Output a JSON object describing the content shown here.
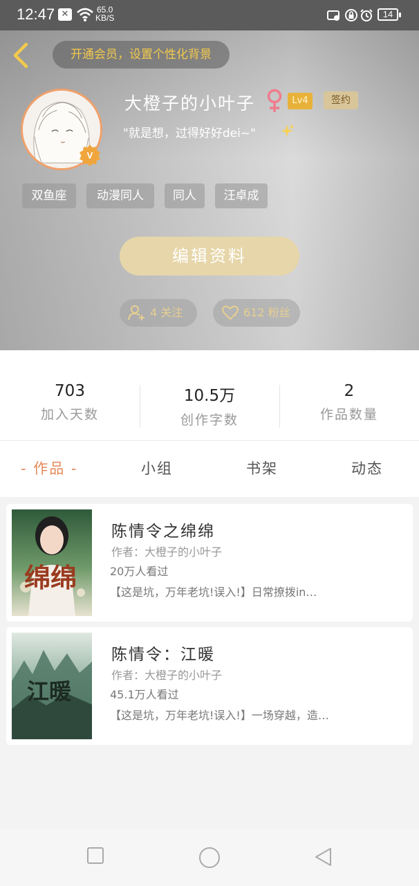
{
  "status": {
    "time": "12:47",
    "net_speed": "65.0",
    "net_unit": "KB/S",
    "battery": "14"
  },
  "header": {
    "vip_banner": "开通会员，设置个性化背景",
    "username": "大橙子的小叶子",
    "level": "Lv4",
    "sign_badge": "签约",
    "motto": "\"就是想，过得好好dei~\"",
    "avatar_badge": "V",
    "tags": [
      "双鱼座",
      "动漫同人",
      "同人",
      "汪卓成"
    ],
    "edit_button": "编辑资料",
    "follow": "4 关注",
    "fans": "612 粉丝"
  },
  "stats": [
    {
      "value": "703",
      "label": "加入天数"
    },
    {
      "value": "10.5万",
      "label": "创作字数"
    },
    {
      "value": "2",
      "label": "作品数量"
    }
  ],
  "tabs": [
    "- 作品 -",
    "小组",
    "书架",
    "动态"
  ],
  "works": [
    {
      "title": "陈情令之绵绵",
      "author": "作者：大橙子的小叶子",
      "views": "20万人看过",
      "desc": "【这是坑，万年老坑!误入!】日常撩拨in…",
      "cover_text": "绵绵"
    },
    {
      "title": "陈情令：江暖",
      "author": "作者：大橙子的小叶子",
      "views": "45.1万人看过",
      "desc": "【这是坑，万年老坑!误入!】一场穿越，造…",
      "cover_text": "江暖"
    }
  ],
  "colors": {
    "accent": "#e4895a",
    "gold": "#f2c94c",
    "level": "#e8b23a"
  }
}
